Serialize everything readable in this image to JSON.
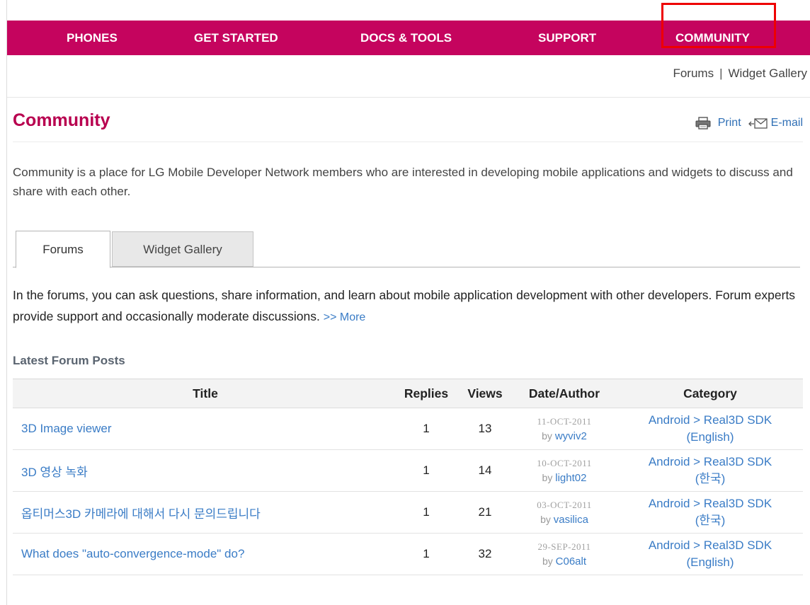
{
  "nav": {
    "items": [
      "PHONES",
      "GET STARTED",
      "DOCS & TOOLS",
      "SUPPORT",
      "COMMUNITY"
    ],
    "highlighted": "COMMUNITY",
    "color": "#c5045e"
  },
  "subnav": {
    "forums": "Forums",
    "separator": "|",
    "widget_gallery": "Widget Gallery"
  },
  "page": {
    "title": "Community",
    "print": "Print",
    "email": "E-mail",
    "intro": "Community is a place for LG Mobile Developer Network members who are interested in developing mobile applications and widgets to discuss and share with each other."
  },
  "tabs": [
    {
      "label": "Forums",
      "active": true
    },
    {
      "label": "Widget Gallery",
      "active": false
    }
  ],
  "forum": {
    "description": "In the forums, you can ask questions, share information, and learn about mobile application development with other developers. Forum experts provide support and occasionally moderate discussions.",
    "more": ">> More"
  },
  "latest": {
    "heading": "Latest Forum Posts",
    "columns": [
      "Title",
      "Replies",
      "Views",
      "Date/Author",
      "Category"
    ],
    "by_label": "by",
    "rows": [
      {
        "title": "3D Image viewer",
        "replies": "1",
        "views": "13",
        "date": "11-OCT-2011",
        "author": "wyviv2",
        "category_1": "Android > Real3D SDK",
        "category_2": "(English)"
      },
      {
        "title": "3D 영상 녹화",
        "replies": "1",
        "views": "14",
        "date": "10-OCT-2011",
        "author": "light02",
        "category_1": "Android > Real3D SDK",
        "category_2": "(한국)"
      },
      {
        "title": "옵티머스3D 카메라에 대해서 다시 문의드립니다",
        "replies": "1",
        "views": "21",
        "date": "03-OCT-2011",
        "author": "vasilica",
        "category_1": "Android > Real3D SDK",
        "category_2": "(한국)"
      },
      {
        "title": "What does \"auto-convergence-mode\" do?",
        "replies": "1",
        "views": "32",
        "date": "29-SEP-2011",
        "author": "C06alt",
        "category_1": "Android > Real3D SDK",
        "category_2": "(English)"
      }
    ]
  }
}
